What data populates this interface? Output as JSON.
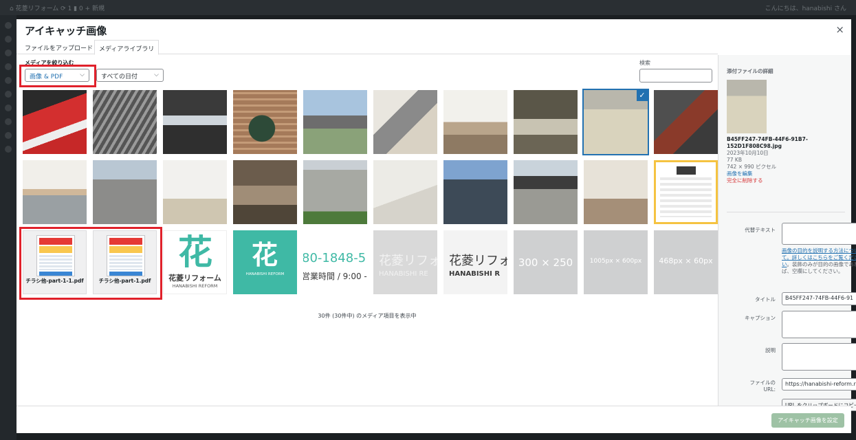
{
  "admin_bar": {
    "left_text": "⌂ 花菱リフォーム  ⟳ 1  ▮ 0  + 新規",
    "right_text": "こんにちは、hanabishi さん"
  },
  "modal": {
    "title": "アイキャッチ画像",
    "close_glyph": "×",
    "tabs": [
      {
        "label": "ファイルをアップロード"
      },
      {
        "label": "メディアライブラリ"
      }
    ]
  },
  "filters": {
    "label": "メディアを絞り込む",
    "type_value": "画像 & PDF",
    "date_value": "すべての日付",
    "chevron": "⌵",
    "search_label": "検索"
  },
  "grid": {
    "selected_check": "✓",
    "pdfs": [
      {
        "name": "チラシ他-part-1-1.pdf"
      },
      {
        "name": "チラシ他-part-1.pdf"
      }
    ],
    "logo1": {
      "mark": "花",
      "ja": "花菱リフォーム",
      "en": "HANABISHI REFORM"
    },
    "logo2": {
      "mark": "花",
      "en": "HANABISHI REFORM"
    },
    "phone": {
      "big": "80-1848-5",
      "small": "営業時間 / 9:00 -"
    },
    "faded": {
      "big": "花菱リフォ",
      "small": "HANABISHI RE"
    },
    "dark": {
      "big": "花菱リフォ",
      "small": "HANABISHI R"
    },
    "placeholders": [
      "300 × 250",
      "1005px × 600px",
      "468px × 60px"
    ],
    "count": "30件 (30件中) のメディア項目を表示中"
  },
  "details": {
    "heading": "添付ファイルの詳細",
    "filename": "B45FF247-74FB-44F6-91B7-152D1F808C98.jpg",
    "date": "2023年10月10日",
    "size": "77 KB",
    "dimensions": "742 × 990 ピクセル",
    "edit_link": "画像を編集",
    "delete_link": "完全に削除する",
    "alt_label": "代替テキスト",
    "alt_help_link": "画像の目的を説明する方法について。詳しくはこちらをご覧ください",
    "alt_help_text": "。装飾のみが目的の画像であれば、空欄にしてください。",
    "title_label": "タイトル",
    "title_value": "B45FF247-74FB-44F6-91",
    "caption_label": "キャプション",
    "description_label": "説明",
    "url_label": "ファイルの URL:",
    "url_value": "https://hanabishi-reform.r",
    "copy_button": "URL をクリップボードにコピー"
  },
  "footer": {
    "set_button": "アイキャッチ画像を設定"
  },
  "colors": {
    "accent": "#2271b1",
    "highlight": "#e0212b",
    "brand": "#3fb9a5",
    "disabled_primary": "#9ec2a5"
  }
}
